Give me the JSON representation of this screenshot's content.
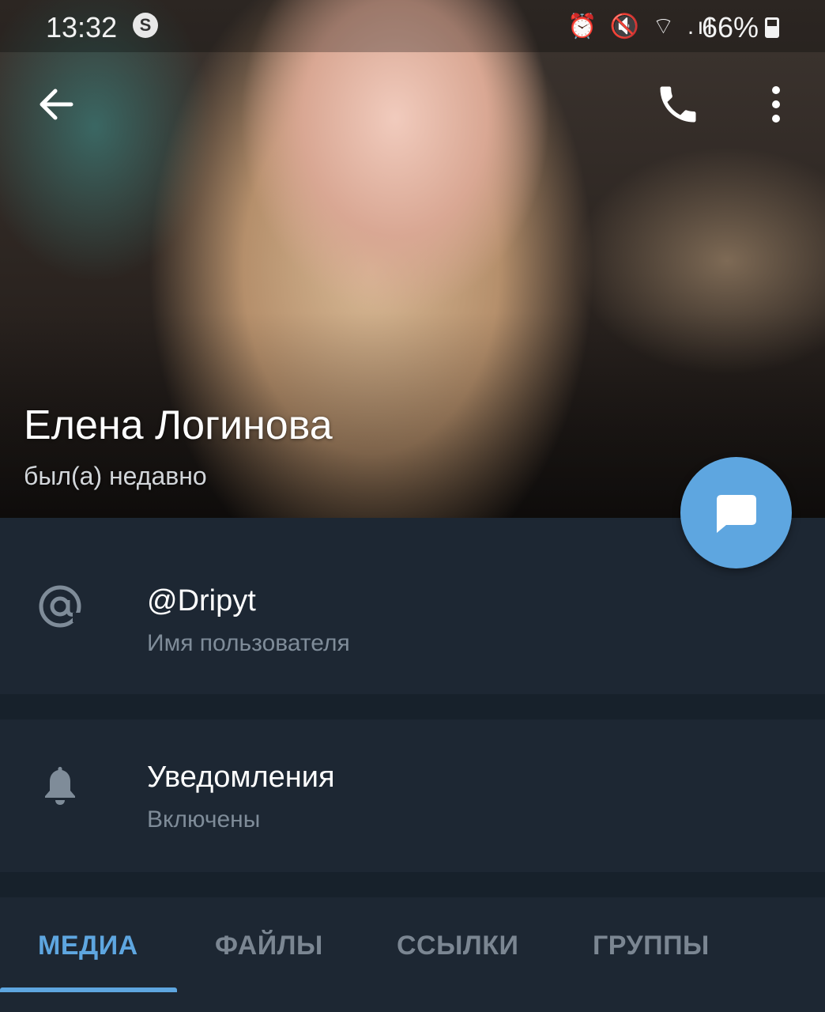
{
  "status_bar": {
    "time": "13:32",
    "system_icons": "⏰ 🔇 ⌔ .ıl",
    "battery": "66%"
  },
  "profile": {
    "name": "Елена Логинова",
    "last_seen": "был(а) недавно"
  },
  "info": {
    "username": "@Dripyt",
    "username_caption": "Имя пользователя",
    "notifications_title": "Уведомления",
    "notifications_status": "Включены"
  },
  "tabs": [
    {
      "label": "МЕДИА",
      "active": true
    },
    {
      "label": "ФАЙЛЫ",
      "active": false
    },
    {
      "label": "ССЫЛКИ",
      "active": false
    },
    {
      "label": "ГРУППЫ",
      "active": false
    }
  ],
  "colors": {
    "background": "#17212b",
    "section": "#1d2733",
    "accent": "#5ea6e0",
    "secondary_text": "#7f8c99"
  }
}
